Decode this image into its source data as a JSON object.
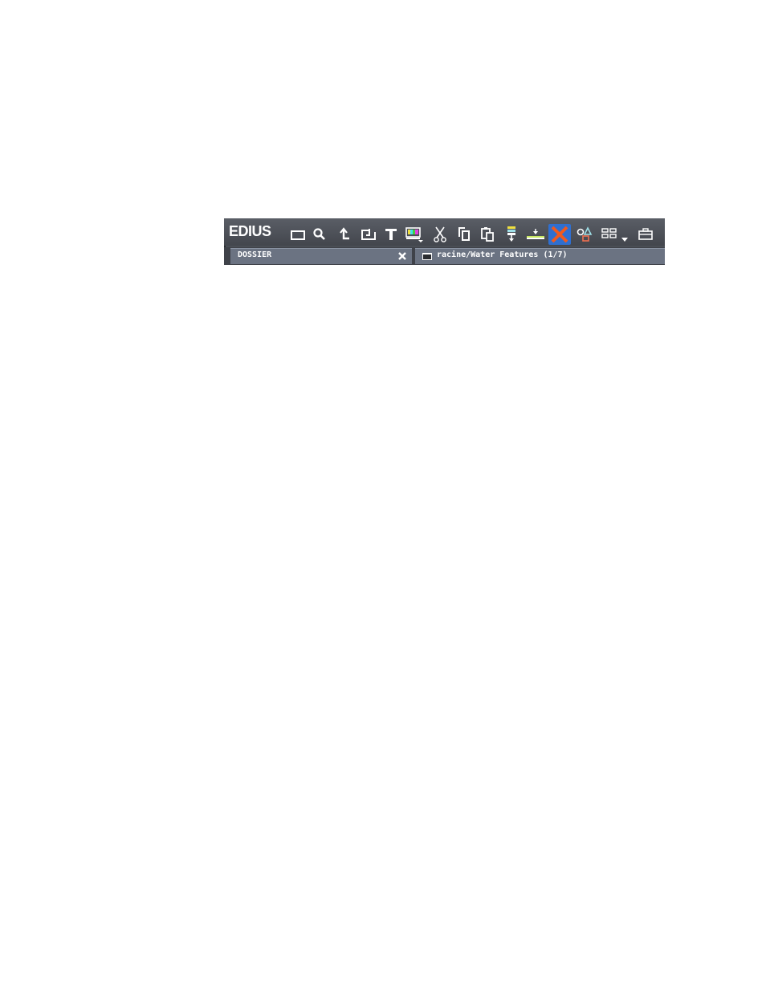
{
  "app": {
    "logo_text": "EDIUS"
  },
  "toolbar": {
    "buttons": [
      {
        "id": "new-folder",
        "icon": "folder-icon"
      },
      {
        "id": "search",
        "icon": "search-icon"
      },
      {
        "id": "up-level",
        "icon": "up-arrow-icon"
      },
      {
        "id": "open-clip",
        "icon": "open-clip-icon"
      },
      {
        "id": "add-title",
        "icon": "title-t-icon"
      },
      {
        "id": "new-sequence",
        "icon": "color-bars-icon"
      },
      {
        "id": "cut",
        "icon": "scissors-icon"
      },
      {
        "id": "copy",
        "icon": "copy-icon"
      },
      {
        "id": "paste",
        "icon": "paste-icon"
      },
      {
        "id": "add-to-timeline",
        "icon": "insert-timeline-icon"
      },
      {
        "id": "show-in-player",
        "icon": "player-line-icon"
      },
      {
        "id": "delete",
        "icon": "delete-x-icon",
        "active": true
      },
      {
        "id": "properties",
        "icon": "properties-shapes-icon"
      },
      {
        "id": "view",
        "icon": "view-grid-icon"
      },
      {
        "id": "toolbox",
        "icon": "toolbox-icon"
      }
    ],
    "accent_color": "#2f6fd0",
    "delete_color": "#f05a1e"
  },
  "tabs": {
    "folder_label": "DOSSIER",
    "path_label": "racine/Water Features (1/7)"
  }
}
